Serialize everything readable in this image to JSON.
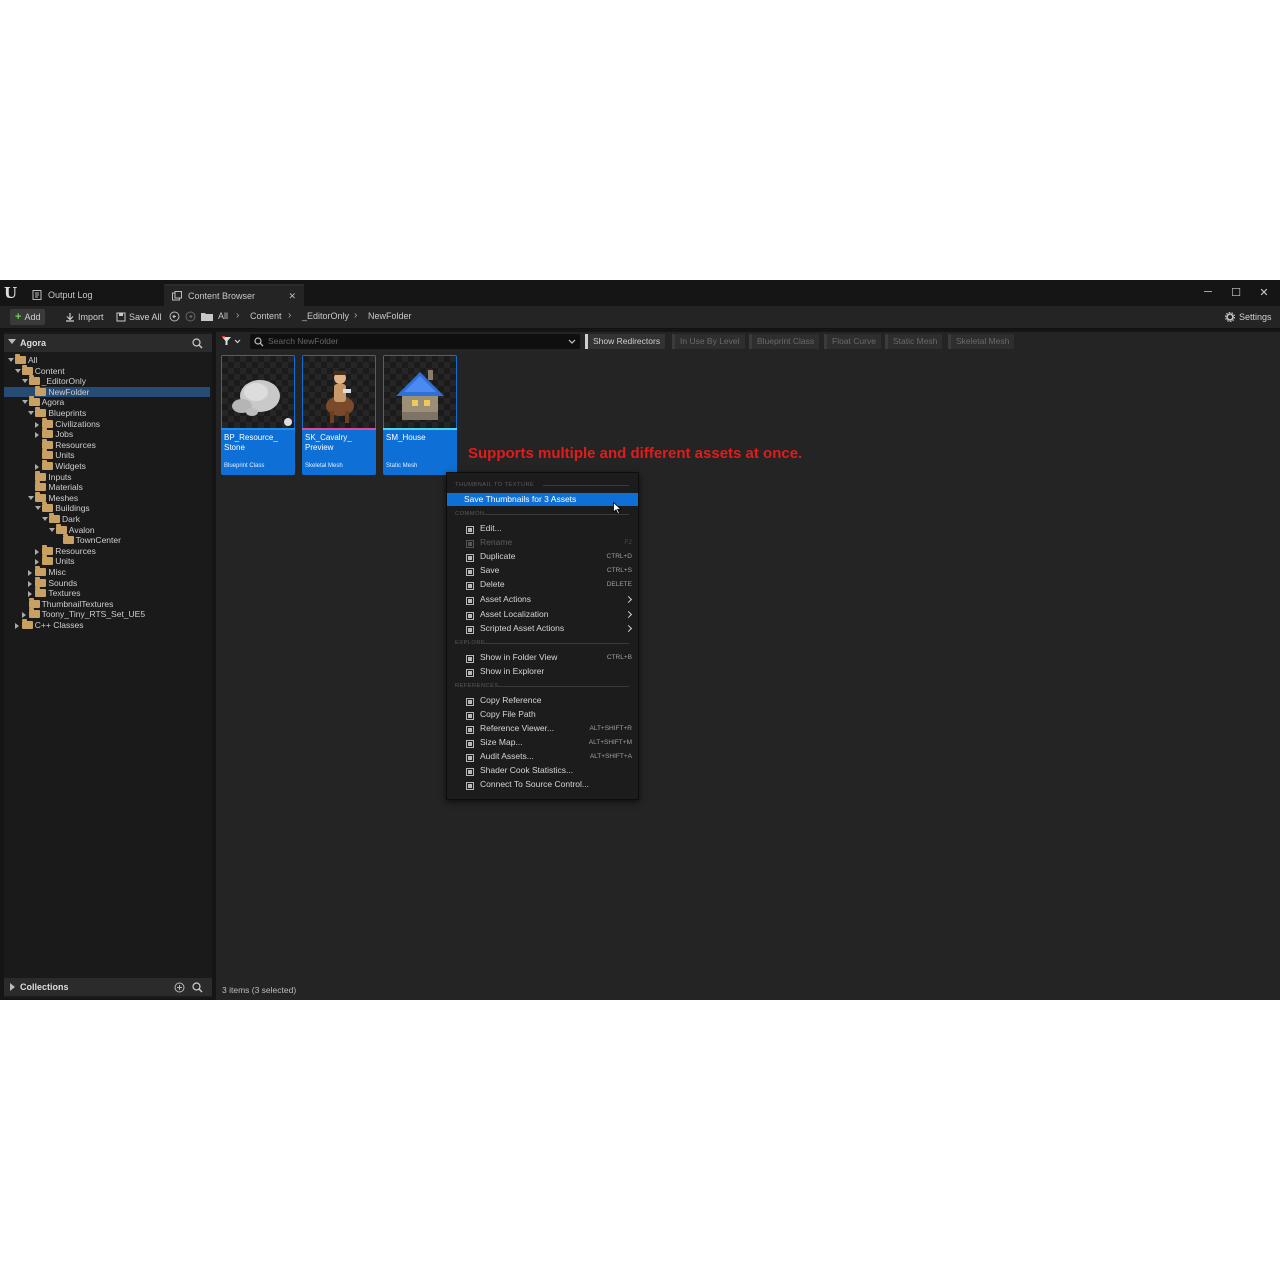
{
  "window": {
    "tabs": [
      {
        "label": "Output Log",
        "icon": "output-log-icon"
      },
      {
        "label": "Content Browser",
        "icon": "content-browser-icon"
      }
    ],
    "controls": {
      "minimize": "─",
      "maximize": "☐",
      "close": "✕",
      "tab_close": "✕"
    }
  },
  "toolbar": {
    "add": "Add",
    "import": "Import",
    "save_all": "Save All",
    "breadcrumb": [
      "All",
      "Content",
      "_EditorOnly",
      "NewFolder"
    ],
    "settings": "Settings"
  },
  "sources": {
    "header": "Agora",
    "tree": [
      {
        "label": "All",
        "depth": 0,
        "state": "open"
      },
      {
        "label": "Content",
        "depth": 1,
        "state": "open"
      },
      {
        "label": "_EditorOnly",
        "depth": 2,
        "state": "open"
      },
      {
        "label": "NewFolder",
        "depth": 3,
        "state": "none",
        "selected": true
      },
      {
        "label": "Agora",
        "depth": 2,
        "state": "open"
      },
      {
        "label": "Blueprints",
        "depth": 3,
        "state": "open"
      },
      {
        "label": "Civilizations",
        "depth": 4,
        "state": "closed"
      },
      {
        "label": "Jobs",
        "depth": 4,
        "state": "closed"
      },
      {
        "label": "Resources",
        "depth": 4,
        "state": "none"
      },
      {
        "label": "Units",
        "depth": 4,
        "state": "none"
      },
      {
        "label": "Widgets",
        "depth": 4,
        "state": "closed"
      },
      {
        "label": "Inputs",
        "depth": 3,
        "state": "none"
      },
      {
        "label": "Materials",
        "depth": 3,
        "state": "none"
      },
      {
        "label": "Meshes",
        "depth": 3,
        "state": "open"
      },
      {
        "label": "Buildings",
        "depth": 4,
        "state": "open"
      },
      {
        "label": "Dark",
        "depth": 5,
        "state": "open"
      },
      {
        "label": "Avalon",
        "depth": 6,
        "state": "open"
      },
      {
        "label": "TownCenter",
        "depth": 7,
        "state": "none"
      },
      {
        "label": "Resources",
        "depth": 4,
        "state": "closed"
      },
      {
        "label": "Units",
        "depth": 4,
        "state": "closed"
      },
      {
        "label": "Misc",
        "depth": 3,
        "state": "closed"
      },
      {
        "label": "Sounds",
        "depth": 3,
        "state": "closed"
      },
      {
        "label": "Textures",
        "depth": 3,
        "state": "closed"
      },
      {
        "label": "ThumbnailTextures",
        "depth": 2,
        "state": "none"
      },
      {
        "label": "Toony_Tiny_RTS_Set_UE5",
        "depth": 2,
        "state": "closed"
      },
      {
        "label": "C++ Classes",
        "depth": 1,
        "state": "closed"
      }
    ],
    "collections": "Collections"
  },
  "filters": {
    "search_placeholder": "Search NewFolder",
    "chips": [
      {
        "label": "Show Redirectors",
        "active": true
      },
      {
        "label": "In Use By Level",
        "active": false
      },
      {
        "label": "Blueprint Class",
        "active": false
      },
      {
        "label": "Float Curve",
        "active": false
      },
      {
        "label": "Static Mesh",
        "active": false
      },
      {
        "label": "Skeletal Mesh",
        "active": false
      }
    ]
  },
  "assets": [
    {
      "name": "BP_Resource_\nStone",
      "type": "Blueprint Class",
      "color": "#1e8fe6"
    },
    {
      "name": "SK_Cavalry_\nPreview",
      "type": "Skeletal Mesh",
      "color": "#e04a9a"
    },
    {
      "name": "SM_House",
      "type": "Static Mesh",
      "color": "#4fd6e6"
    }
  ],
  "annotation": "Supports multiple and different assets at once.",
  "status": "3 items (3 selected)",
  "context_menu": {
    "sections": [
      "THUMBNAIL TO TEXTURE",
      "COMMON",
      "EXPLORE",
      "REFERENCES"
    ],
    "items": [
      {
        "label": "Save Thumbnails for 3 Assets",
        "shortcut": "",
        "icon": "",
        "highlighted": true,
        "disabled": false,
        "submenu": false
      },
      {
        "label": "Edit...",
        "shortcut": "",
        "icon": "edit-icon",
        "highlighted": false,
        "disabled": false,
        "submenu": false
      },
      {
        "label": "Rename",
        "shortcut": "F2",
        "icon": "rename-icon",
        "highlighted": false,
        "disabled": true,
        "submenu": false
      },
      {
        "label": "Duplicate",
        "shortcut": "CTRL+D",
        "icon": "duplicate-icon",
        "highlighted": false,
        "disabled": false,
        "submenu": false
      },
      {
        "label": "Save",
        "shortcut": "CTRL+S",
        "icon": "save-icon",
        "highlighted": false,
        "disabled": false,
        "submenu": false
      },
      {
        "label": "Delete",
        "shortcut": "DELETE",
        "icon": "delete-icon",
        "highlighted": false,
        "disabled": false,
        "submenu": false
      },
      {
        "label": "Asset Actions",
        "shortcut": "",
        "icon": "wrench-icon",
        "highlighted": false,
        "disabled": false,
        "submenu": true
      },
      {
        "label": "Asset Localization",
        "shortcut": "",
        "icon": "flag-icon",
        "highlighted": false,
        "disabled": false,
        "submenu": true
      },
      {
        "label": "Scripted Asset Actions",
        "shortcut": "",
        "icon": "script-icon",
        "highlighted": false,
        "disabled": false,
        "submenu": true
      },
      {
        "label": "Show in Folder View",
        "shortcut": "CTRL+B",
        "icon": "folder-view-icon",
        "highlighted": false,
        "disabled": false,
        "submenu": false
      },
      {
        "label": "Show in Explorer",
        "shortcut": "",
        "icon": "explorer-icon",
        "highlighted": false,
        "disabled": false,
        "submenu": false
      },
      {
        "label": "Copy Reference",
        "shortcut": "",
        "icon": "copy-icon",
        "highlighted": false,
        "disabled": false,
        "submenu": false
      },
      {
        "label": "Copy File Path",
        "shortcut": "",
        "icon": "copy-icon",
        "highlighted": false,
        "disabled": false,
        "submenu": false
      },
      {
        "label": "Reference Viewer...",
        "shortcut": "ALT+SHIFT+R",
        "icon": "reference-viewer-icon",
        "highlighted": false,
        "disabled": false,
        "submenu": false
      },
      {
        "label": "Size Map...",
        "shortcut": "ALT+SHIFT+M",
        "icon": "size-map-icon",
        "highlighted": false,
        "disabled": false,
        "submenu": false
      },
      {
        "label": "Audit Assets...",
        "shortcut": "ALT+SHIFT+A",
        "icon": "audit-icon",
        "highlighted": false,
        "disabled": false,
        "submenu": false
      },
      {
        "label": "Shader Cook Statistics...",
        "shortcut": "",
        "icon": "shader-icon",
        "highlighted": false,
        "disabled": false,
        "submenu": false
      },
      {
        "label": "Connect To Source Control...",
        "shortcut": "",
        "icon": "source-control-icon",
        "highlighted": false,
        "disabled": false,
        "submenu": false
      }
    ]
  }
}
